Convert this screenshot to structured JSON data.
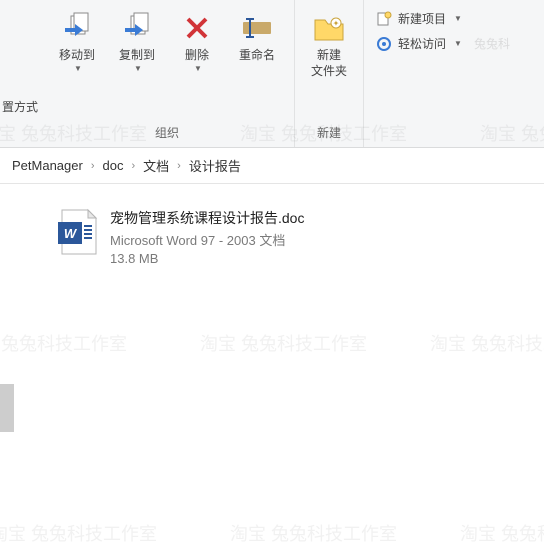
{
  "ribbon": {
    "left_label": "置方式",
    "move_to": "移动到",
    "copy_to": "复制到",
    "delete": "删除",
    "rename": "重命名",
    "new_folder": "新建\n文件夹",
    "group_organize": "组织",
    "group_new": "新建",
    "new_item": "新建项目",
    "easy_access": "轻松访问",
    "easy_access_extra": "兔兔科"
  },
  "breadcrumb": {
    "items": [
      "PetManager",
      "doc",
      "文档",
      "设计报告"
    ]
  },
  "file": {
    "name": "宠物管理系统课程设计报告.doc",
    "type": "Microsoft Word 97 - 2003 文档",
    "size": "13.8 MB"
  },
  "watermark": "淘宝 兔兔科技工作室"
}
